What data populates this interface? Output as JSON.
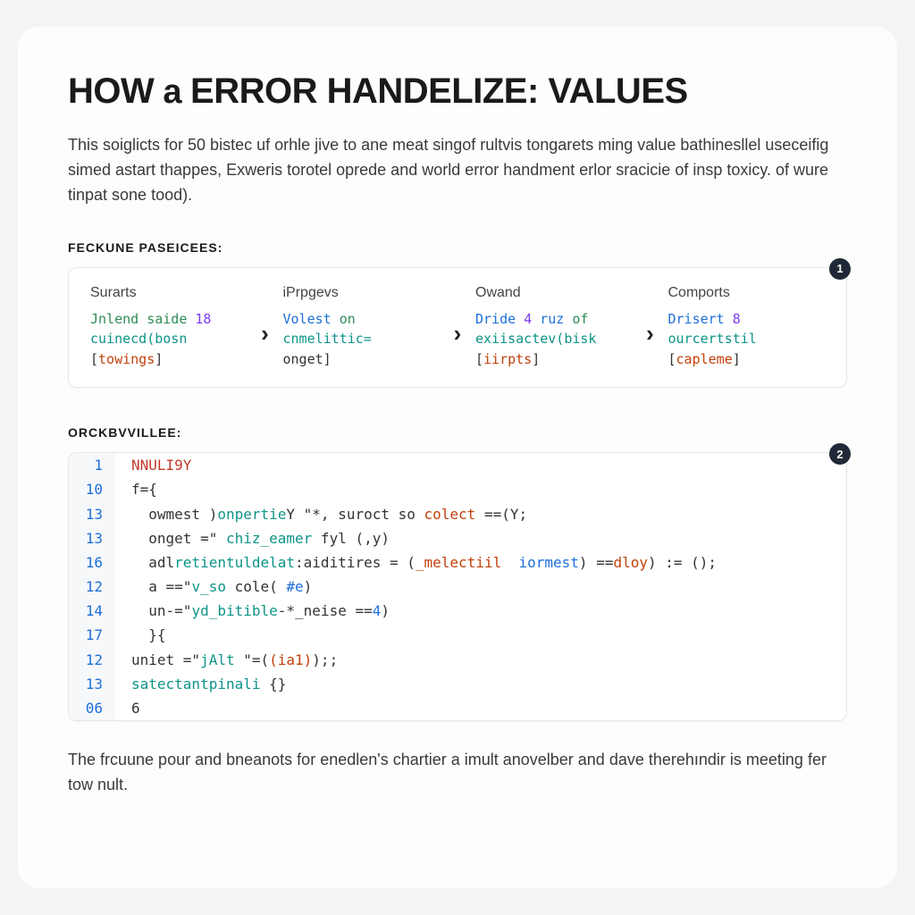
{
  "title_parts": [
    "HOW",
    " a ",
    "ERROR HANDELIZE: VALUES"
  ],
  "intro": "This soiglicts for 50 bistec uf orhle jive to ane meat singof rultvis tongarets ming value bathinesllel useceifig simed astart thappes, Exweris torotel oprede and world error handment erlor sracicie of insp toxicy. of wure tinpat sone tood).",
  "section1_label": "FECKUNE PASEICEES:",
  "flow_badge": "1",
  "flow": [
    {
      "head": "Surarts",
      "l1a": "Jnlend saide ",
      "l1b": "18",
      "l2": "cuinecd(bosn",
      "l3a": "[",
      "l3b": "towings",
      "l3c": "]"
    },
    {
      "head": "iPrpgevs",
      "l1a": "Volest ",
      "l1b": "on",
      "l2": "cnmelittic=",
      "l3": "onget]"
    },
    {
      "head": "Owand",
      "l1a": "Dride ",
      "l1b": "4",
      "l1c": " ruz ",
      "l1d": "of",
      "l2": "exiisactev(bisk",
      "l3a": "[",
      "l3b": "iirpts",
      "l3c": "]"
    },
    {
      "head": "Comports",
      "l1a": "Drisert ",
      "l1b": "8",
      "l2": "ourcertstil",
      "l3a": "[",
      "l3b": "capleme",
      "l3c": "]"
    }
  ],
  "section2_label": "ORCKBVVILLEE:",
  "code_badge": "2",
  "code_lines": [
    {
      "n": "1",
      "tokens": [
        [
          "NNULI9Y",
          "kw-red"
        ]
      ]
    },
    {
      "n": "10",
      "tokens": [
        [
          "f={",
          ""
        ]
      ]
    },
    {
      "n": "13",
      "tokens": [
        [
          "  ",
          ""
        ],
        [
          "owmest",
          ""
        ],
        [
          " )",
          ""
        ],
        [
          "onpertie",
          "tk-teal"
        ],
        [
          "Y ",
          ""
        ],
        [
          "\"*",
          ""
        ],
        [
          ", ",
          ""
        ],
        [
          "suroct",
          ""
        ],
        [
          " so ",
          ""
        ],
        [
          "colect",
          "tk-orange"
        ],
        [
          " ==",
          ""
        ],
        [
          "(Y;",
          ""
        ]
      ]
    },
    {
      "n": "13",
      "tokens": [
        [
          "  ",
          ""
        ],
        [
          "onget",
          ""
        ],
        [
          " =\" ",
          ""
        ],
        [
          "chiz_eamer",
          "tk-teal"
        ],
        [
          " fyl (,y)",
          ""
        ]
      ]
    },
    {
      "n": "16",
      "tokens": [
        [
          "  ",
          ""
        ],
        [
          "adl",
          ""
        ],
        [
          "retientuldelat",
          "tk-teal"
        ],
        [
          ":aiditires = (",
          ""
        ],
        [
          "_melectiil",
          "tk-orange"
        ],
        [
          "  ",
          ""
        ],
        [
          "iormest",
          "tk-blue"
        ],
        [
          ") ==",
          ""
        ],
        [
          "dloy",
          "tk-orange"
        ],
        [
          ") := ();",
          ""
        ]
      ]
    },
    {
      "n": "12",
      "tokens": [
        [
          "  a ==\"",
          ""
        ],
        [
          "v_so",
          "tk-teal"
        ],
        [
          " cole( ",
          ""
        ],
        [
          "#e",
          "tk-blue"
        ],
        [
          ")",
          ""
        ]
      ]
    },
    {
      "n": "14",
      "tokens": [
        [
          "  un-=\"",
          ""
        ],
        [
          "yd_bitible",
          "tk-teal"
        ],
        [
          "-*_neise ==",
          ""
        ],
        [
          "4",
          "tk-blue"
        ],
        [
          ")",
          ""
        ]
      ]
    },
    {
      "n": "17",
      "tokens": [
        [
          "  }{",
          ""
        ]
      ]
    },
    {
      "n": "12",
      "tokens": [
        [
          "uniet =\"",
          ""
        ],
        [
          "jAlt",
          "tk-teal"
        ],
        [
          " \"=(",
          ""
        ],
        [
          "(ia1)",
          "tk-orange"
        ],
        [
          ");;",
          ""
        ]
      ]
    },
    {
      "n": "13",
      "tokens": [
        [
          "satectantpinali",
          "tk-teal"
        ],
        [
          " {}",
          ""
        ]
      ]
    },
    {
      "n": "06",
      "tokens": [
        [
          "6",
          ""
        ]
      ]
    }
  ],
  "footer": "The frcuune pour and bneanots for enedlen's chartier a imult anovelber and dave therehındir is meeting fer tow nult."
}
